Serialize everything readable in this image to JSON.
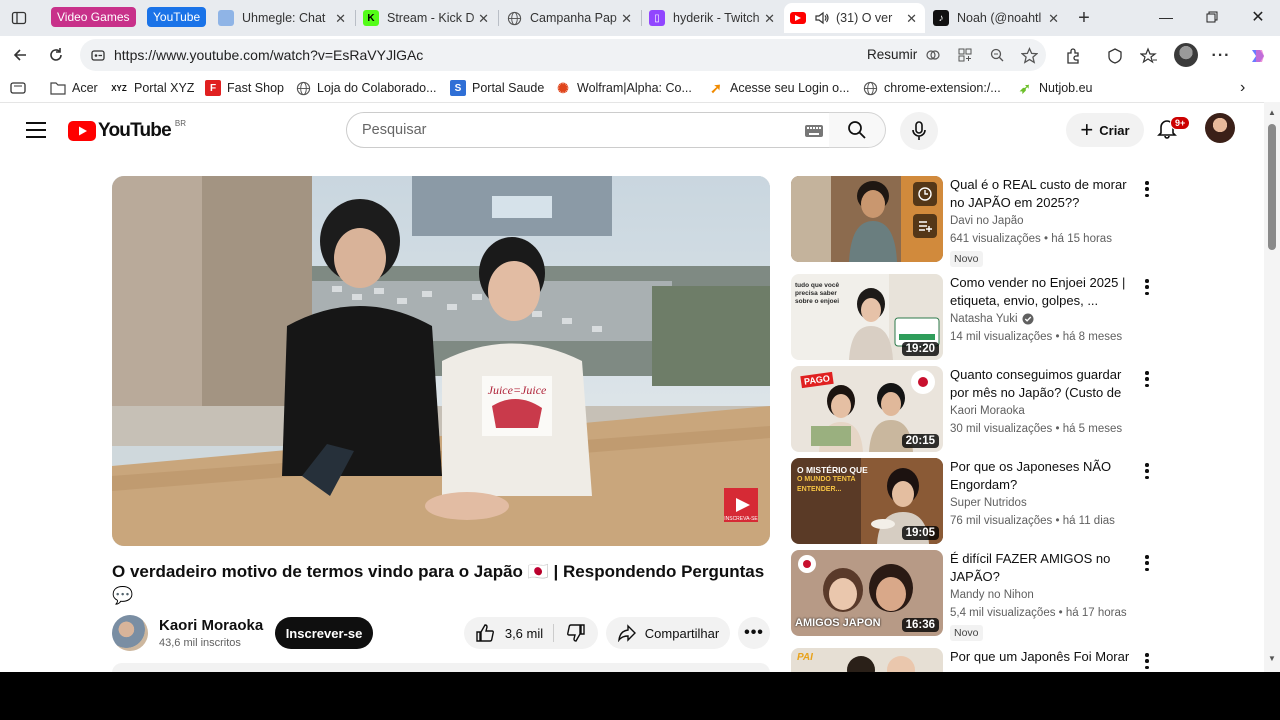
{
  "browser": {
    "tab_groups": [
      {
        "label": "Video Games",
        "color": "#c8318a"
      },
      {
        "label": "YouTube",
        "color": "#1a73e8"
      }
    ],
    "tabs": [
      {
        "title": "Uhmegle: Chat",
        "favicon_color": "#8fb4e6"
      },
      {
        "title": "Stream - Kick D",
        "favicon_color": "#53fc18"
      },
      {
        "title": "Campanha Pap",
        "favicon_color": "#777777"
      },
      {
        "title": "hyderik - Twitch",
        "favicon_color": "#9146ff"
      },
      {
        "title": "(31) O ver",
        "favicon_color": "#ff0000",
        "active": true
      },
      {
        "title": "Noah (@noahtl",
        "favicon_color": "#111111"
      }
    ],
    "url": "https://www.youtube.com/watch?v=EsRaVYJlGAc",
    "resumir_label": "Resumir",
    "bookmarks": [
      {
        "label": "Acer",
        "icon": "folder-icon"
      },
      {
        "label": "Portal XYZ",
        "icon": "xyz-icon"
      },
      {
        "label": "Fast Shop",
        "icon": "fastshop-icon"
      },
      {
        "label": "Loja do Colaborado...",
        "icon": "globe-icon"
      },
      {
        "label": "Portal Saude",
        "icon": "portal-saude-icon"
      },
      {
        "label": "Wolfram|Alpha: Co...",
        "icon": "wolfram-icon"
      },
      {
        "label": "Acesse seu Login o...",
        "icon": "login-icon"
      },
      {
        "label": "chrome-extension:/...",
        "icon": "globe-icon"
      },
      {
        "label": "Nutjob.eu",
        "icon": "nutjob-icon"
      }
    ]
  },
  "youtube": {
    "logo_text": "YouTube",
    "logo_region": "BR",
    "search_placeholder": "Pesquisar",
    "create_label": "Criar",
    "notification_count": "9+",
    "video": {
      "title": "O verdadeiro motivo de termos vindo para o Japão 🇯🇵 | Respondendo Perguntas 💬",
      "watermark": "INSCREVA-SE",
      "channel": "Kaori Moraoka",
      "subscribers": "43,6 mil inscritos",
      "subscribe_label": "Inscrever-se",
      "likes": "3,6 mil",
      "share_label": "Compartilhar",
      "more_label": "•••"
    },
    "recommendations": [
      {
        "title": "Qual é o REAL custo de morar no JAPÃO em 2025??",
        "channel": "Davi no Japão",
        "views": "641 visualizações",
        "age": "há 15 horas",
        "badge": "Novo",
        "duration": "",
        "verified": false
      },
      {
        "title": "Como vender no Enjoei 2025 | etiqueta, envio, golpes, ...",
        "channel": "Natasha Yuki",
        "views": "14 mil visualizações",
        "age": "há 8 meses",
        "badge": "",
        "duration": "19:20",
        "verified": true
      },
      {
        "title": "Quanto conseguimos guardar por mês no Japão? (Custo de ...",
        "channel": "Kaori Moraoka",
        "views": "30 mil visualizações",
        "age": "há 5 meses",
        "badge": "",
        "duration": "20:15",
        "verified": false
      },
      {
        "title": "Por que os Japoneses NÃO Engordam?",
        "channel": "Super Nutridos",
        "views": "76 mil visualizações",
        "age": "há 11 dias",
        "badge": "",
        "duration": "19:05",
        "verified": false
      },
      {
        "title": "É difícil FAZER AMIGOS  no JAPÃO?",
        "channel": "Mandy no Nihon",
        "views": "5,4 mil visualizações",
        "age": "há 17 horas",
        "badge": "Novo",
        "duration": "16:36",
        "verified": false
      },
      {
        "title": "Por que um Japonês Foi Morar",
        "channel": "",
        "views": "",
        "age": "",
        "badge": "",
        "duration": "",
        "verified": false
      }
    ],
    "thumb_texts": {
      "r2": [
        "tudo que você",
        "precisa saber",
        "sobre o enjoei"
      ],
      "r3": "PAGO",
      "r4": [
        "O MISTÉRIO QUE",
        "O MUNDO TENTA",
        "ENTENDER..."
      ],
      "r5": "AMIGOS JAPON",
      "r6": "PAI"
    }
  },
  "colors": {
    "youtube_red": "#ff0000",
    "accent_blue": "#1a73e8"
  }
}
